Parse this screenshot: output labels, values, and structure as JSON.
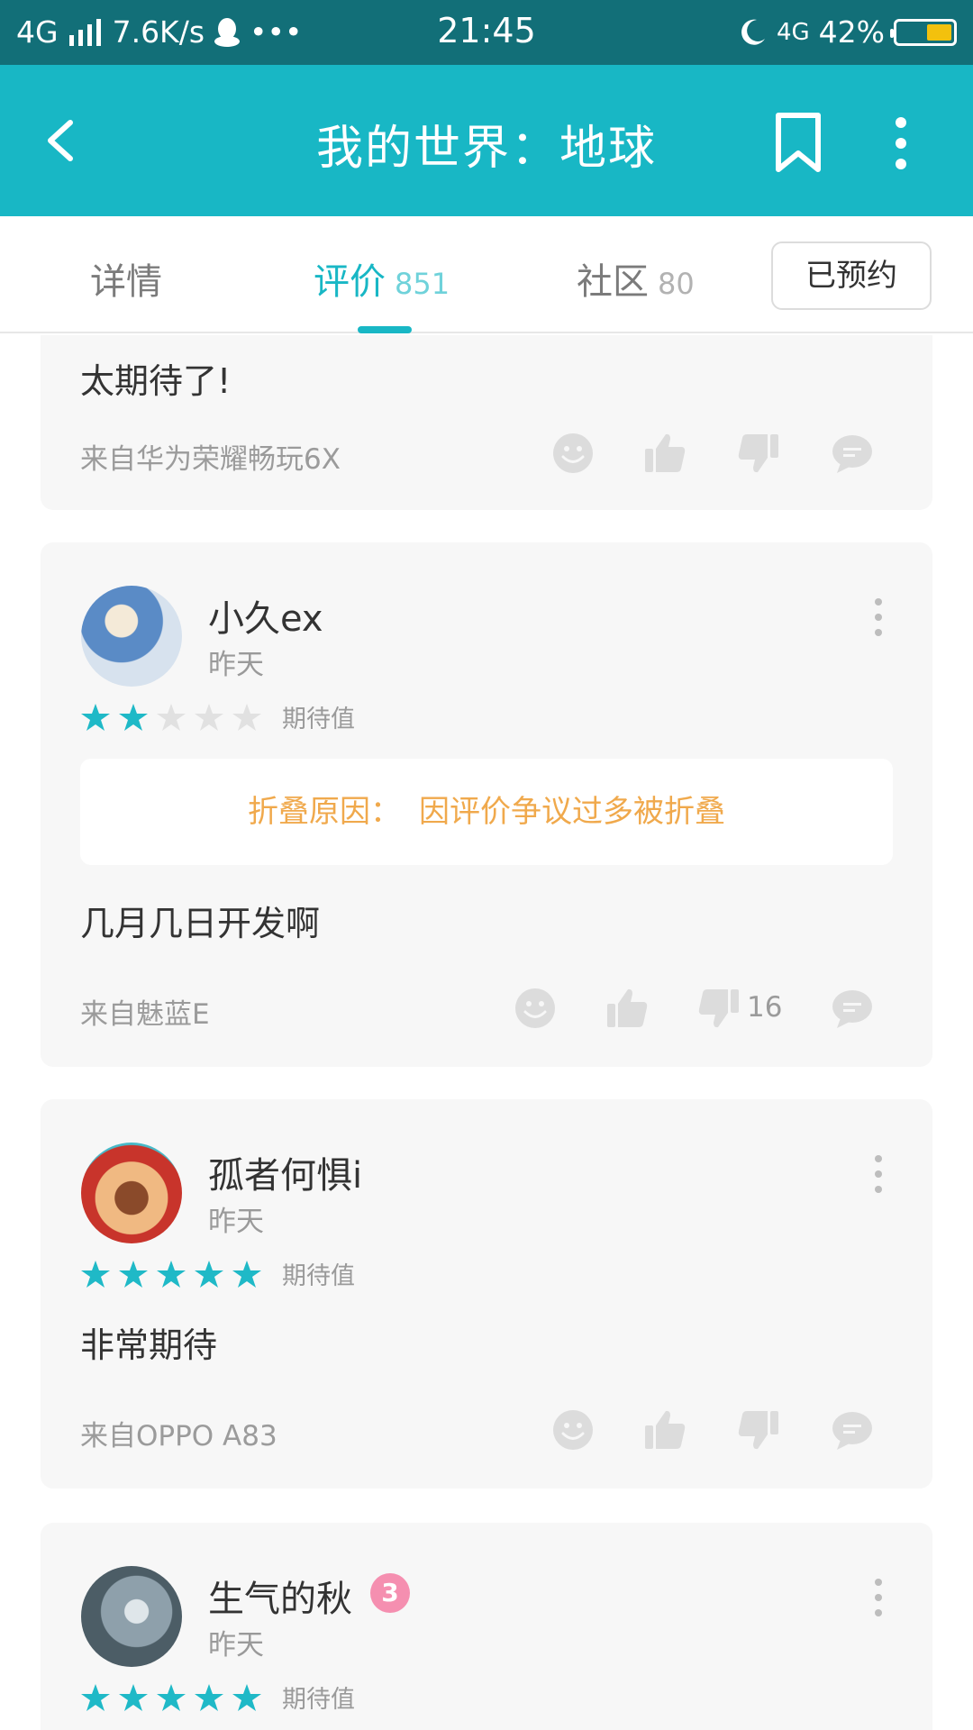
{
  "status_bar": {
    "network": "4G",
    "speed": "7.6K/s",
    "dots": "•••",
    "time": "21:45",
    "network_right": "4G",
    "battery": "42%",
    "battery_level": 0.42
  },
  "app_bar": {
    "title": "我的世界：地球"
  },
  "tabs": [
    {
      "label": "详情",
      "count": ""
    },
    {
      "label": "评价",
      "count": "851"
    },
    {
      "label": "社区",
      "count": "80"
    }
  ],
  "reserve_button": "已预约",
  "reviews": [
    {
      "text": "太期待了!",
      "from": "来自华为荣耀畅玩6X"
    },
    {
      "name": "小久ex",
      "time": "昨天",
      "stars": 2,
      "rating_label": "期待值",
      "fold_label": "折叠原因：",
      "fold_reason": "因评价争议过多被折叠",
      "text": "几月几日开发啊",
      "from": "来自魅蓝E",
      "dislike_count": "16"
    },
    {
      "name": "孤者何惧i",
      "time": "昨天",
      "stars": 5,
      "rating_label": "期待值",
      "text": "非常期待",
      "from": "来自OPPO A83"
    },
    {
      "name": "生气的秋",
      "time": "昨天",
      "stars": 5,
      "rating_label": "期待值",
      "badge": "3"
    }
  ]
}
